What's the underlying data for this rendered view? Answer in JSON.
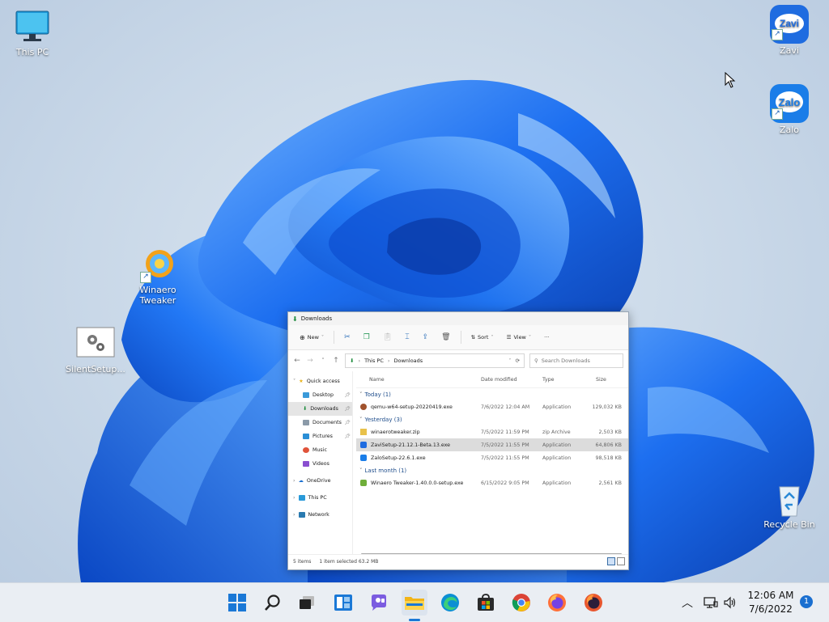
{
  "desktop": {
    "icons": [
      {
        "label": "This PC"
      },
      {
        "label": "Zavi",
        "logo_text": "Zavi"
      },
      {
        "label": "Zalo",
        "logo_text": "Zalo"
      },
      {
        "label": "Winaero Tweaker"
      },
      {
        "label": "SilentSetup..."
      },
      {
        "label": "Recycle Bin"
      }
    ]
  },
  "explorer": {
    "title": "Downloads",
    "toolbar": {
      "new_label": "New",
      "sort_label": "Sort",
      "view_label": "View",
      "more_label": "···"
    },
    "address": {
      "crumbs": [
        "This PC",
        "Downloads"
      ],
      "search_placeholder": "Search Downloads"
    },
    "nav": {
      "quick_access": "Quick access",
      "items": [
        "Desktop",
        "Downloads",
        "Documents",
        "Pictures",
        "Music",
        "Videos"
      ],
      "onedrive": "OneDrive",
      "this_pc": "This PC",
      "network": "Network"
    },
    "columns": {
      "name": "Name",
      "date": "Date modified",
      "type": "Type",
      "size": "Size"
    },
    "groups": [
      {
        "label": "Today (1)",
        "files": [
          {
            "name": "qemu-w64-setup-20220419.exe",
            "date": "7/6/2022 12:04 AM",
            "type": "Application",
            "size": "129,032 KB"
          }
        ]
      },
      {
        "label": "Yesterday (3)",
        "files": [
          {
            "name": "winaerotweaker.zip",
            "date": "7/5/2022 11:59 PM",
            "type": "zip Archive",
            "size": "2,503 KB"
          },
          {
            "name": "ZaviSetup-21.12.1-Beta.13.exe",
            "date": "7/5/2022 11:55 PM",
            "type": "Application",
            "size": "64,806 KB"
          },
          {
            "name": "ZaloSetup-22.6.1.exe",
            "date": "7/5/2022 11:55 PM",
            "type": "Application",
            "size": "98,518 KB"
          }
        ]
      },
      {
        "label": "Last month (1)",
        "files": [
          {
            "name": "Winaero Tweaker-1.40.0.0-setup.exe",
            "date": "6/15/2022 9:05 PM",
            "type": "Application",
            "size": "2,561 KB"
          }
        ]
      }
    ],
    "status": {
      "count": "5 items",
      "selected": "1 item selected  63.2 MB"
    }
  },
  "taskbar": {
    "apps": [
      "start-icon",
      "search-icon",
      "task-view-icon",
      "widgets-icon",
      "chat-icon",
      "file-explorer-icon",
      "edge-icon",
      "store-icon",
      "chrome-icon",
      "firefox-icon",
      "firefox-dev-icon"
    ],
    "time": "12:06 AM",
    "date": "7/6/2022",
    "notifications": "1"
  },
  "colors": {
    "accent": "#0067c0",
    "wallpaper_blue": "#1a6fe0",
    "zavi_blue": "#1f6ce0"
  }
}
